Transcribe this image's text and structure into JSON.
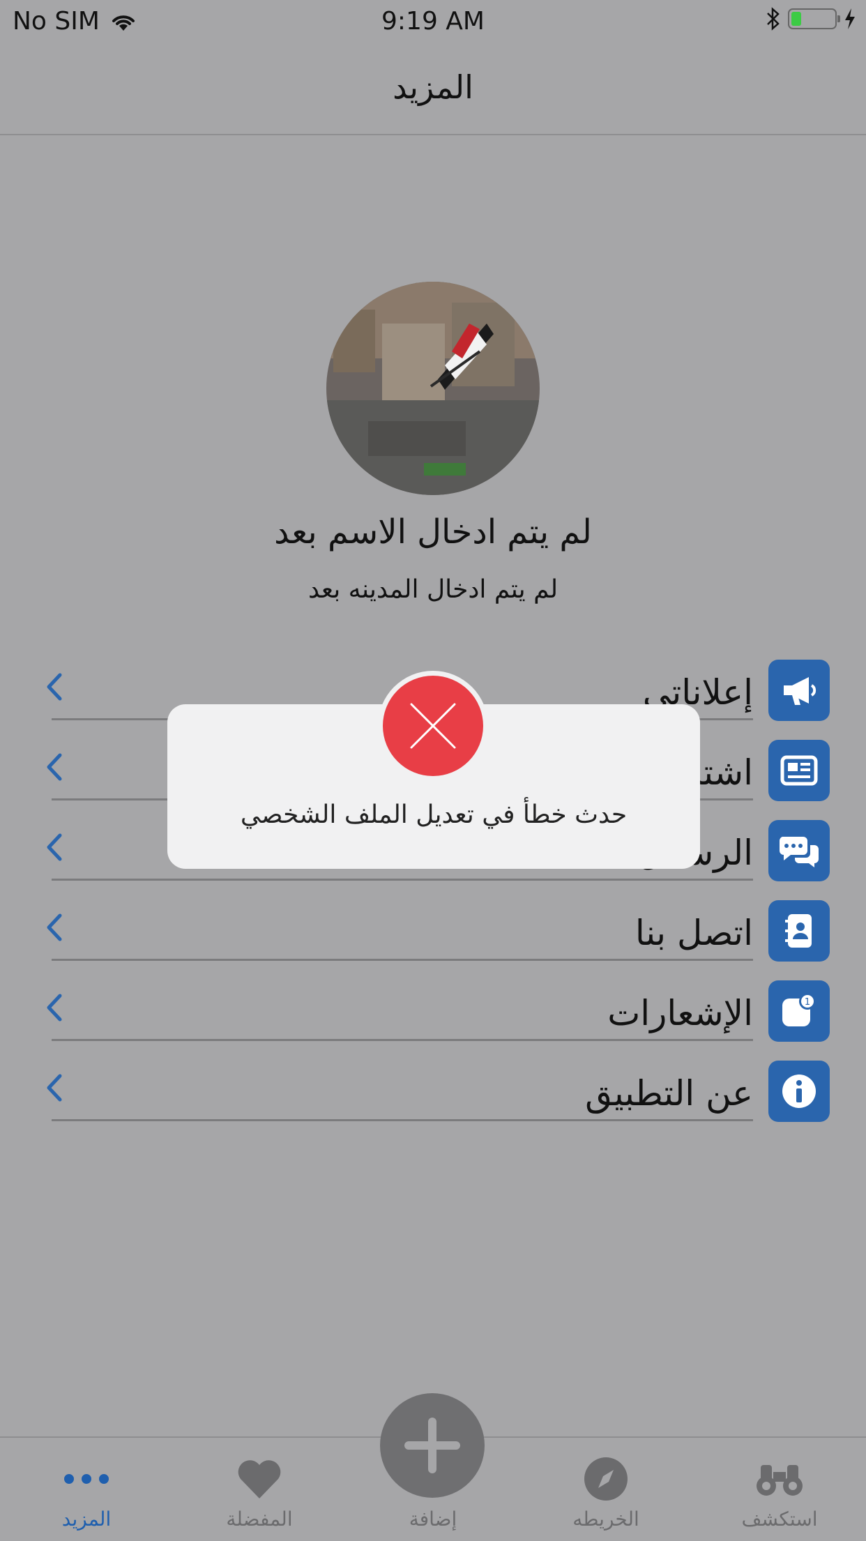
{
  "status_bar": {
    "carrier": "No SIM",
    "time": "9:19 AM"
  },
  "navbar": {
    "title": "المزيد"
  },
  "profile": {
    "name": "لم يتم ادخال الاسم بعد",
    "city": "لم يتم ادخال المدينه بعد"
  },
  "menu": {
    "items": [
      {
        "label": "إعلاناتي",
        "icon": "megaphone-icon"
      },
      {
        "label": "اشتراكاتي",
        "icon": "newspaper-icon"
      },
      {
        "label": "الرسائل",
        "icon": "chat-bubbles-icon"
      },
      {
        "label": "اتصل بنا",
        "icon": "contact-book-icon"
      },
      {
        "label": "الإشعارات",
        "icon": "notification-badge-icon"
      },
      {
        "label": "عن التطبيق",
        "icon": "info-icon"
      }
    ]
  },
  "alert": {
    "message": "حدث خطأ في تعديل الملف الشخصي",
    "icon": "error-x-icon",
    "accent": "#e83e46"
  },
  "tabbar": {
    "tabs": [
      {
        "label": "المزيد",
        "icon": "more-dots-icon",
        "active": true
      },
      {
        "label": "المفضلة",
        "icon": "heart-icon",
        "active": false
      },
      {
        "label": "إضافة",
        "icon": "plus-icon",
        "active": false
      },
      {
        "label": "الخريطه",
        "icon": "compass-icon",
        "active": false
      },
      {
        "label": "استكشف",
        "icon": "binoculars-icon",
        "active": false
      }
    ]
  },
  "colors": {
    "accent": "#2a65ad",
    "active_tab": "#1f5fae",
    "overlay_bg": "#a6a6a8"
  }
}
